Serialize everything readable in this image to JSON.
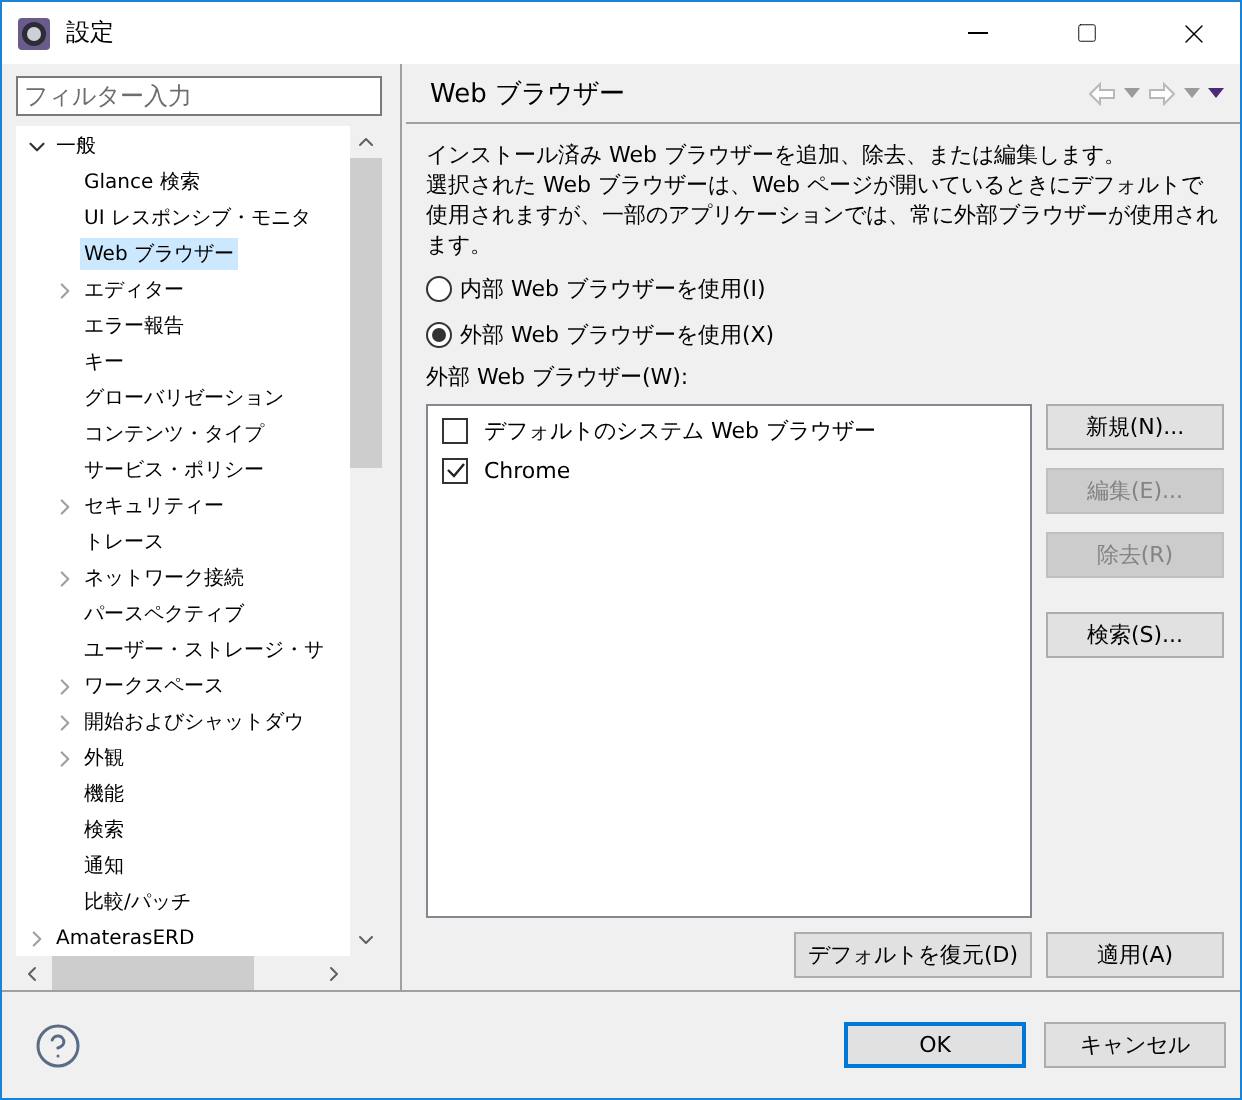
{
  "window": {
    "title": "設定"
  },
  "filter": {
    "placeholder": "フィルター入力"
  },
  "tree": {
    "items": [
      {
        "label": "一般",
        "expanded": true,
        "selected": false,
        "children": [
          {
            "label": "Glance 検索",
            "selected": false
          },
          {
            "label": "UI レスポンシブ・モニタ",
            "selected": false
          },
          {
            "label": "Web ブラウザー",
            "selected": true
          },
          {
            "label": "エディター",
            "expanded": false,
            "selected": false
          },
          {
            "label": "エラー報告",
            "selected": false
          },
          {
            "label": "キー",
            "selected": false
          },
          {
            "label": "グローバリゼーション",
            "selected": false
          },
          {
            "label": "コンテンツ・タイプ",
            "selected": false
          },
          {
            "label": "サービス・ポリシー",
            "selected": false
          },
          {
            "label": "セキュリティー",
            "expanded": false,
            "selected": false
          },
          {
            "label": "トレース",
            "selected": false
          },
          {
            "label": "ネットワーク接続",
            "expanded": false,
            "selected": false
          },
          {
            "label": "パースペクティブ",
            "selected": false
          },
          {
            "label": "ユーザー・ストレージ・サ",
            "selected": false
          },
          {
            "label": "ワークスペース",
            "expanded": false,
            "selected": false
          },
          {
            "label": "開始およびシャットダウ",
            "expanded": false,
            "selected": false
          },
          {
            "label": "外観",
            "expanded": false,
            "selected": false
          },
          {
            "label": "機能",
            "selected": false
          },
          {
            "label": "検索",
            "selected": false
          },
          {
            "label": "通知",
            "selected": false
          },
          {
            "label": "比較/パッチ",
            "selected": false
          }
        ]
      },
      {
        "label": "AmaterasERD",
        "expanded": false,
        "selected": false
      }
    ]
  },
  "page": {
    "title": "Web ブラウザー",
    "description": [
      "インストール済み Web ブラウザーを追加、除去、または編集します。",
      "選択された Web ブラウザーは、Web ページが開いているときにデフォルトで使用されますが、一部のアプリケーションでは、常に外部ブラウザーが使用されます。"
    ],
    "radios": [
      {
        "label": "内部 Web ブラウザーを使用(I)",
        "selected": false
      },
      {
        "label": "外部 Web ブラウザーを使用(X)",
        "selected": true
      }
    ],
    "list_label": "外部 Web ブラウザー(W):",
    "browsers": [
      {
        "label": "デフォルトのシステム Web ブラウザー",
        "checked": false
      },
      {
        "label": "Chrome",
        "checked": true
      }
    ],
    "side_buttons": [
      {
        "label": "新規(N)...",
        "disabled": false
      },
      {
        "label": "編集(E)...",
        "disabled": true
      },
      {
        "label": "除去(R)",
        "disabled": true
      },
      {
        "label": "検索(S)...",
        "disabled": false
      }
    ],
    "footer_buttons": [
      {
        "label": "デフォルトを復元(D)",
        "disabled": false
      },
      {
        "label": "適用(A)",
        "disabled": false
      }
    ]
  },
  "dialog_buttons": [
    {
      "label": "OK",
      "default": true
    },
    {
      "label": "キャンセル",
      "default": false
    }
  ]
}
